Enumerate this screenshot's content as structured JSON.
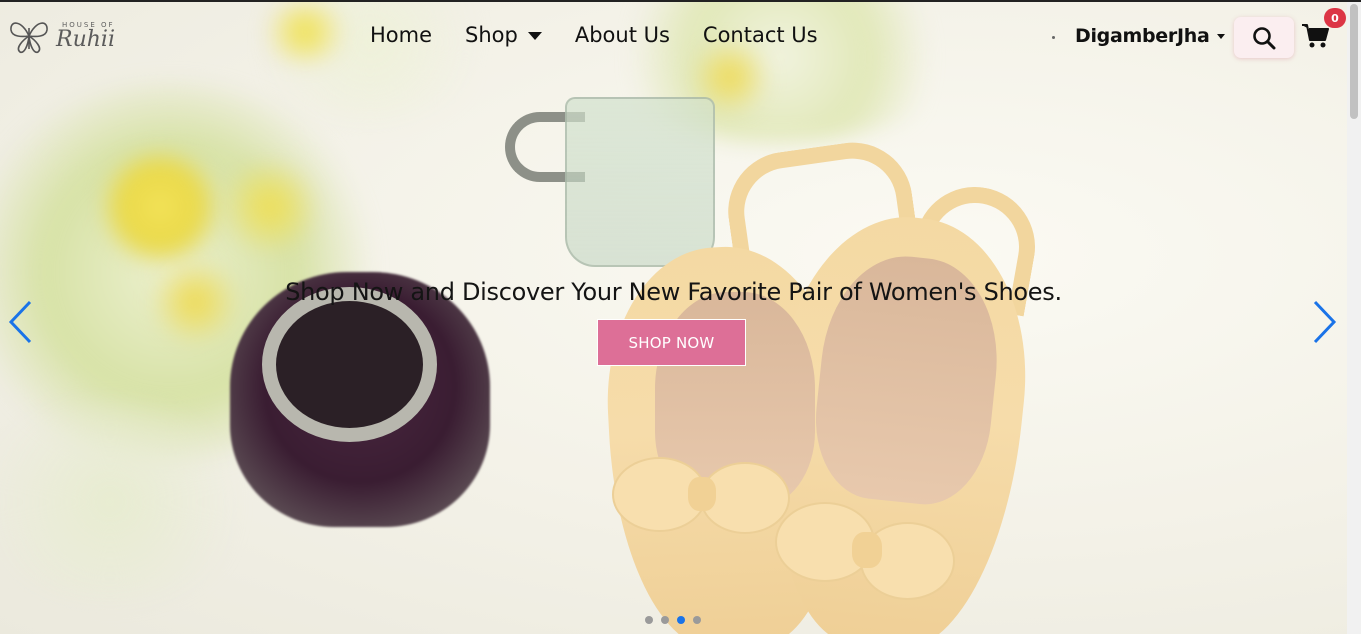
{
  "brand": {
    "sub": "HOUSE OF",
    "name": "Ruhii"
  },
  "nav": {
    "links": [
      {
        "label": "Home"
      },
      {
        "label": "Shop"
      },
      {
        "label": "About Us"
      },
      {
        "label": "Contact Us"
      }
    ]
  },
  "user": {
    "name": "DigamberJha"
  },
  "cart": {
    "count": "0"
  },
  "hero": {
    "caption": "Shop Now and Discover Your New Favorite Pair of Women's Shoes.",
    "button_label": "SHOP NOW",
    "slide_count": 4,
    "active_slide": 2
  },
  "colors": {
    "accent": "#dd6f97",
    "badge": "#dc3545",
    "active_dot": "#1a73e8",
    "arrow": "#1a73e8"
  },
  "icons": [
    "butterfly-logo-icon",
    "chevron-down-icon",
    "search-icon",
    "cart-icon",
    "chevron-left-icon",
    "chevron-right-icon"
  ]
}
